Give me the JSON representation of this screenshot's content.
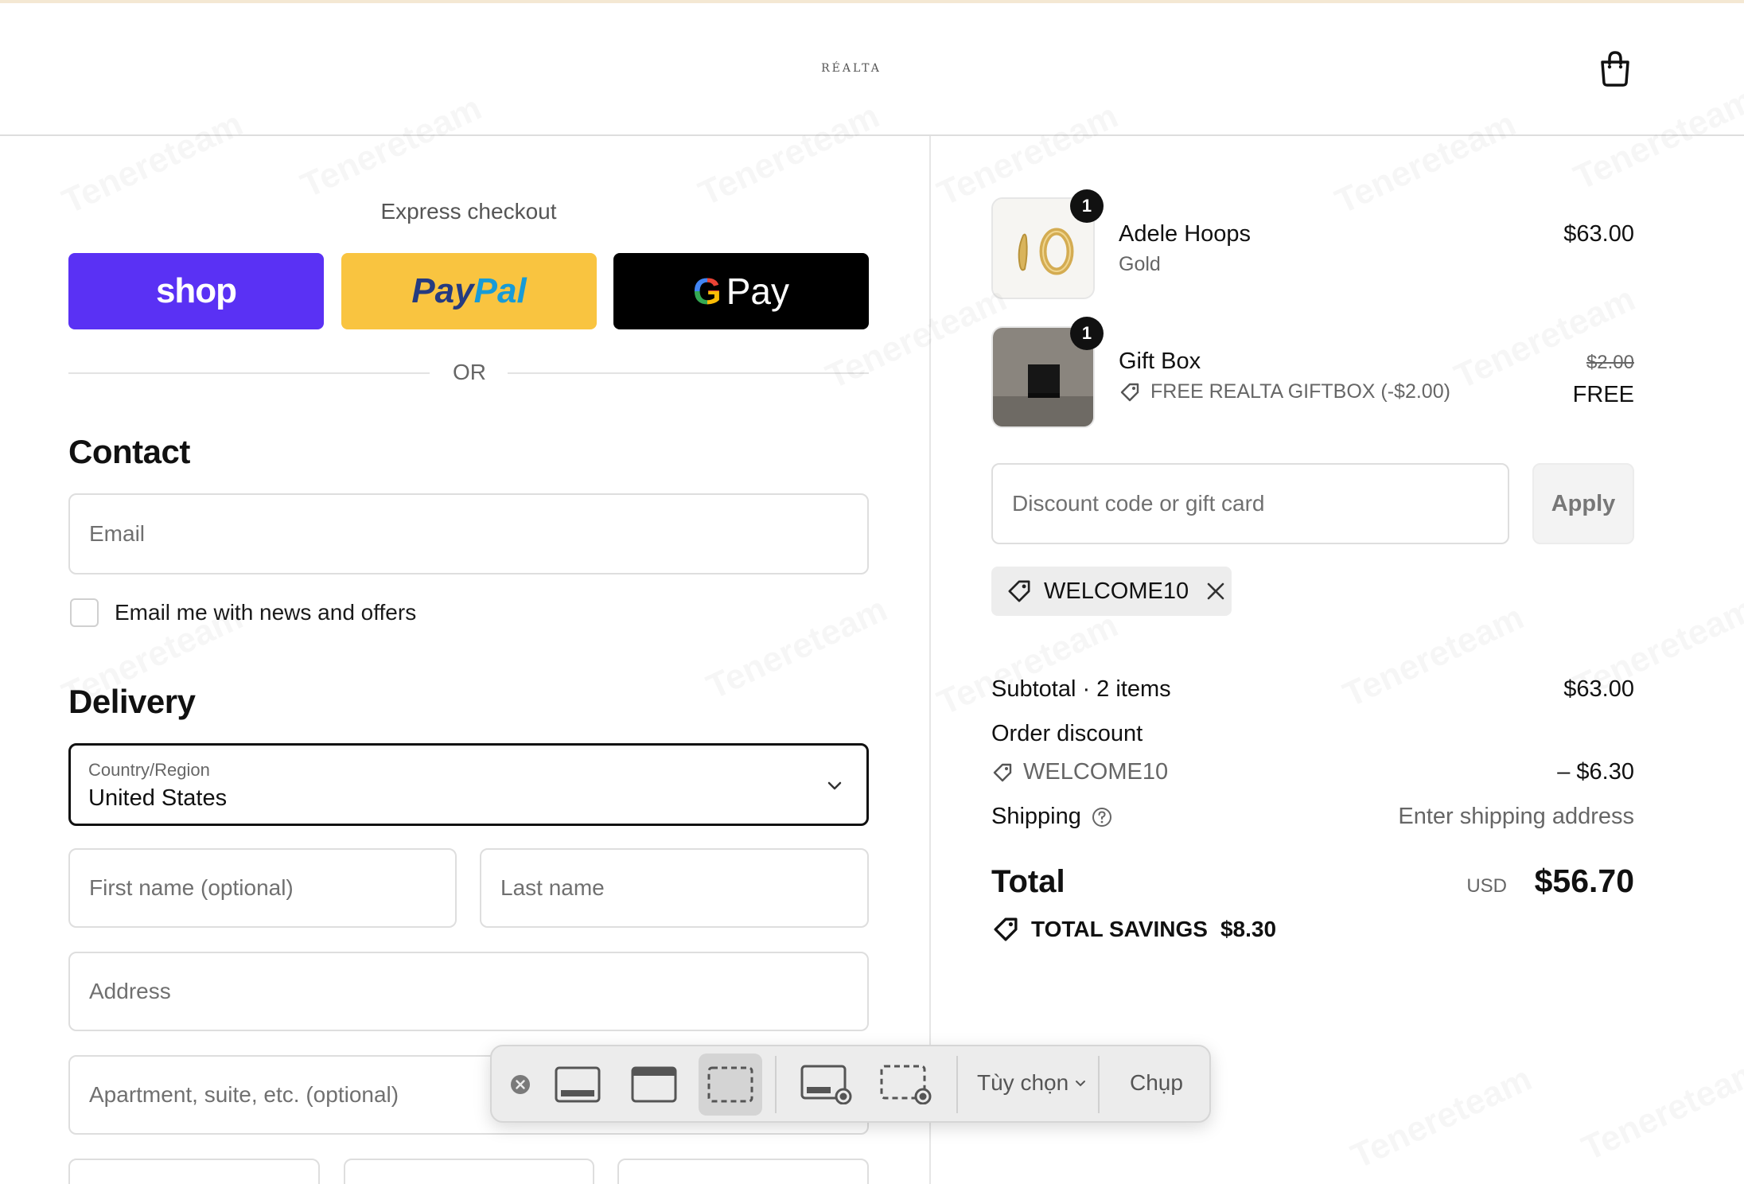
{
  "header": {
    "logo": "RÉALTA"
  },
  "express": {
    "title": "Express checkout",
    "shop_label": "shop",
    "paypal_part1": "Pay",
    "paypal_part2": "Pal",
    "gpay_g": "G",
    "gpay_label": "Pay",
    "or_label": "OR"
  },
  "contact": {
    "title": "Contact",
    "email_placeholder": "Email",
    "newsletter_label": "Email me with news and offers"
  },
  "delivery": {
    "title": "Delivery",
    "country_label": "Country/Region",
    "country_value": "United States",
    "first_name_placeholder": "First name (optional)",
    "last_name_placeholder": "Last name",
    "address_placeholder": "Address",
    "apartment_placeholder": "Apartment, suite, etc. (optional)"
  },
  "cart": {
    "items": [
      {
        "qty": "1",
        "name": "Adele Hoops",
        "variant": "Gold",
        "price": "$63.00"
      },
      {
        "qty": "1",
        "name": "Gift Box",
        "discount_label": "FREE REALTA GIFTBOX (-$2.00)",
        "original_price": "$2.00",
        "price": "FREE"
      }
    ],
    "discount_placeholder": "Discount code or gift card",
    "apply_label": "Apply",
    "applied_code": "WELCOME10"
  },
  "summary": {
    "subtotal_label": "Subtotal · 2 items",
    "subtotal_value": "$63.00",
    "order_discount_label": "Order discount",
    "order_discount_code": "WELCOME10",
    "order_discount_value": "– $6.30",
    "shipping_label": "Shipping",
    "shipping_value": "Enter shipping address",
    "total_label": "Total",
    "total_currency": "USD",
    "total_value": "$56.70",
    "savings_label": "TOTAL SAVINGS",
    "savings_value": "$8.30"
  },
  "toolbar": {
    "options_label": "Tùy chọn",
    "capture_label": "Chụp"
  },
  "watermark": {
    "text": "Tenereteam"
  },
  "colors": {
    "shop": "#5a31f4",
    "paypal": "#f9c440",
    "gpay": "#000000",
    "accent_text": "#111111"
  }
}
